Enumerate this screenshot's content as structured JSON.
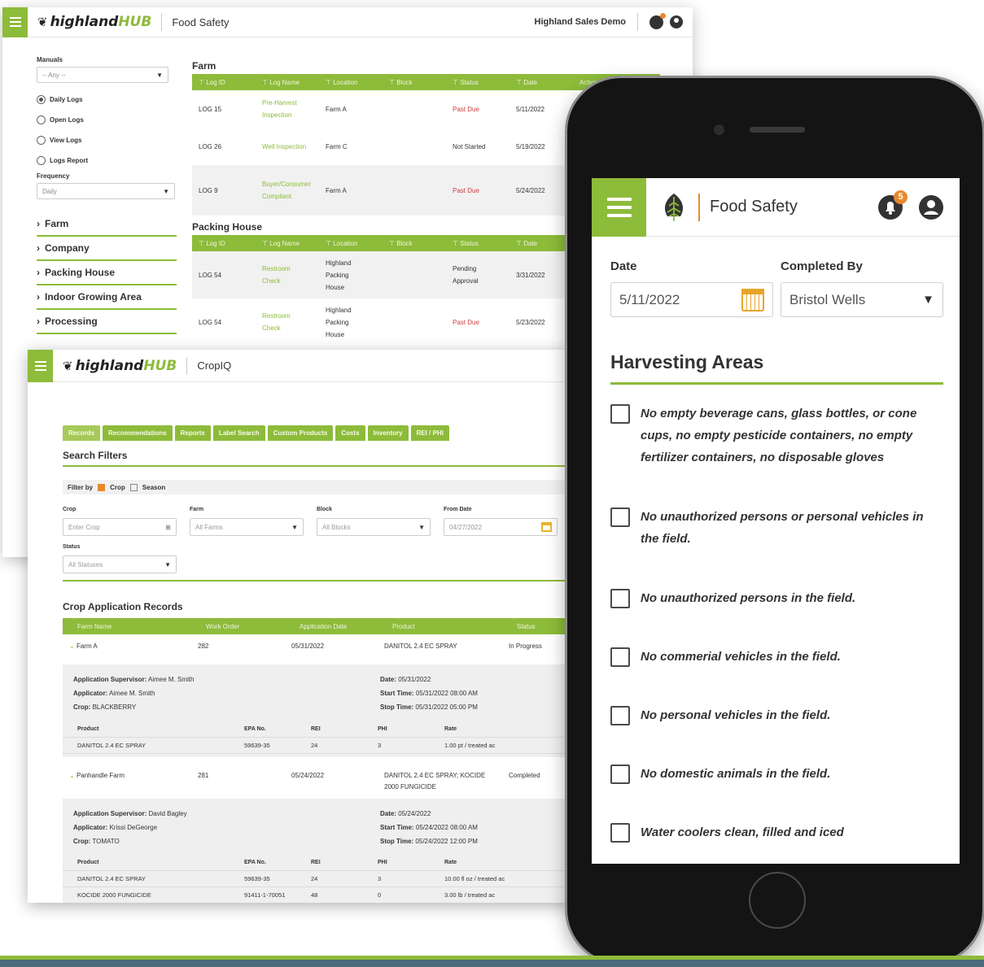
{
  "food_safety_window": {
    "brand": {
      "primary": "highland",
      "secondary": "HUB"
    },
    "title": "Food Safety",
    "org_name": "Highland Sales Demo",
    "sidebar": {
      "manuals_label": "Manuals",
      "manuals_value": "-- Any --",
      "radios": [
        "Daily Logs",
        "Open Logs",
        "View Logs",
        "Logs Report"
      ],
      "frequency_label": "Frequency",
      "frequency_value": "Daily",
      "categories": [
        "Farm",
        "Company",
        "Packing House",
        "Indoor Growing Area",
        "Processing"
      ]
    },
    "farm_section": {
      "title": "Farm",
      "columns": [
        "Log ID",
        "Log Name",
        "Location",
        "Block",
        "Status",
        "Date",
        "Actions"
      ],
      "rows": [
        {
          "id": "LOG 15",
          "name": "Pre-Harvest Inspection",
          "location": "Farm A",
          "block": "",
          "status": "Past Due",
          "date": "5/11/2022"
        },
        {
          "id": "LOG 26",
          "name": "Well Inspection",
          "location": "Farm C",
          "block": "",
          "status": "Not Started",
          "date": "5/19/2022"
        },
        {
          "id": "LOG 9",
          "name": "Buyer/Consumer Compliant",
          "location": "Farm A",
          "block": "",
          "status": "Past Due",
          "date": "5/24/2022"
        }
      ]
    },
    "packing_section": {
      "title": "Packing House",
      "columns": [
        "Log ID",
        "Log Name",
        "Location",
        "Block",
        "Status",
        "Date"
      ],
      "rows": [
        {
          "id": "LOG 54",
          "name": "Restroom Check",
          "location": "Highland Packing House",
          "block": "",
          "status": "Pending Approval",
          "date": "3/31/2022"
        },
        {
          "id": "LOG 54",
          "name": "Restroom Check",
          "location": "Highland Packing House",
          "block": "",
          "status": "Past Due",
          "date": "5/23/2022"
        }
      ]
    }
  },
  "cropiq_window": {
    "brand": {
      "primary": "highland",
      "secondary": "HUB"
    },
    "title": "CropIQ",
    "tabs": [
      "Records",
      "Recommendations",
      "Reports",
      "Label Search",
      "Custom Products",
      "Costs",
      "Inventory",
      "REI / PHI"
    ],
    "search_filters_title": "Search Filters",
    "filter_by": {
      "label": "Filter by",
      "crop": "Crop",
      "season": "Season"
    },
    "fields": {
      "crop_label": "Crop",
      "crop_placeholder": "Enter Crop",
      "farm_label": "Farm",
      "farm_value": "All Farms",
      "block_label": "Block",
      "block_value": "All Blocks",
      "from_date_label": "From Date",
      "from_date_value": "04/27/2022",
      "status_label": "Status",
      "status_value": "All Statuses"
    },
    "records_title": "Crop Application Records",
    "columns": [
      "Farm Name",
      "Work Order",
      "Application Date",
      "Product",
      "Status"
    ],
    "records": [
      {
        "farm": "Farm A",
        "work_order": "282",
        "date": "05/31/2022",
        "product": "DANITOL 2.4 EC SPRAY",
        "status": "In Progress",
        "supervisor": "Aimee M. Smith",
        "applicator": "Aimee M. Smith",
        "crop": "BLACKBERRY",
        "detail_date": "05/31/2022",
        "start_time": "05/31/2022 08:00 AM",
        "stop_time": "05/31/2022 05:00 PM",
        "products": [
          {
            "product": "DANITOL 2.4 EC SPRAY",
            "epa": "59639-35",
            "rei": "24",
            "phi": "3",
            "rate": "1.00 pt / treated ac"
          }
        ]
      },
      {
        "farm": "Panhandle Farm",
        "work_order": "281",
        "date": "05/24/2022",
        "product": "DANITOL 2.4 EC SPRAY; KOCIDE 2000 FUNGICIDE",
        "status": "Completed",
        "supervisor": "David Bagley",
        "applicator": "Krissi DeGeorge",
        "crop": "TOMATO",
        "detail_date": "05/24/2022",
        "start_time": "05/24/2022 08:00 AM",
        "stop_time": "05/24/2022 12:00 PM",
        "products": [
          {
            "product": "DANITOL 2.4 EC SPRAY",
            "epa": "59639-35",
            "rei": "24",
            "phi": "3",
            "rate": "10.00 fl oz / treated ac"
          },
          {
            "product": "KOCIDE 2000 FUNGICIDE",
            "epa": "91411-1-70051",
            "rei": "48",
            "phi": "0",
            "rate": "3.00 lb / treated ac"
          }
        ]
      }
    ],
    "detail_labels": {
      "supervisor": "Application Supervisor:",
      "applicator": "Applicator:",
      "crop": "Crop:",
      "date": "Date:",
      "start": "Start Time:",
      "stop": "Stop Time:",
      "table": [
        "Product",
        "EPA No.",
        "REI",
        "PHI",
        "Rate"
      ]
    }
  },
  "phone_app": {
    "title": "Food Safety",
    "notification_count": "5",
    "date_label": "Date",
    "date_value": "5/11/2022",
    "completed_by_label": "Completed By",
    "completed_by_value": "Bristol Wells",
    "section_title": "Harvesting Areas",
    "checklist": [
      "No empty beverage cans, glass bottles, or cone cups, no empty pesticide containers, no empty fertilizer containers, no disposable gloves",
      "No unauthorized persons or personal vehicles in the field.",
      "No unauthorized persons in the field.",
      "No commerial vehicles in the field.",
      "No personal vehicles in the field.",
      "No domestic animals in the field.",
      "Water coolers clean, filled and iced"
    ]
  },
  "colors": {
    "accent_green": "#8dbb3a",
    "accent_orange": "#e8892a",
    "past_due_red": "#d23b3b"
  }
}
